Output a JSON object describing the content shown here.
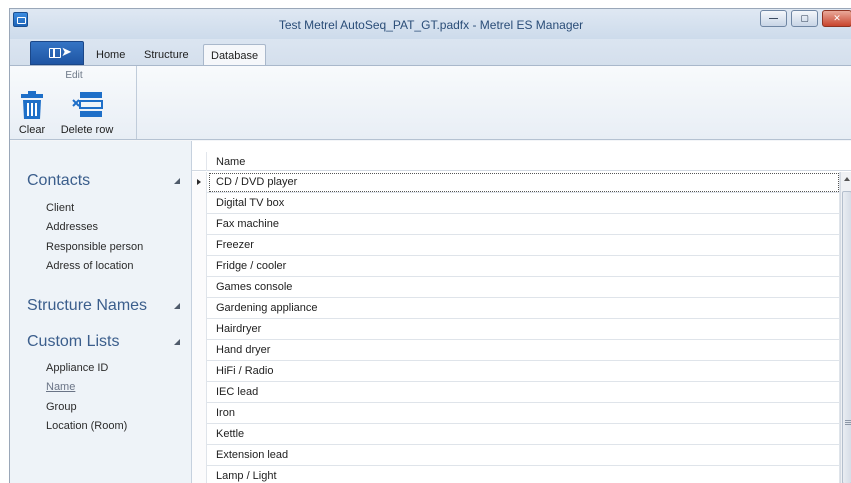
{
  "window": {
    "title": "Test Metrel AutoSeq_PAT_GT.padfx - Metrel ES Manager",
    "controls": {
      "minimize": "—",
      "maximize": "▢",
      "close": "✕"
    }
  },
  "ribbon_tabs": {
    "home": "Home",
    "structure": "Structure",
    "database": "Database",
    "active": "Database"
  },
  "ribbon": {
    "group_label": "Edit",
    "clear_label": "Clear",
    "delete_row_label": "Delete row",
    "icon_color": "#1e6fc8"
  },
  "nav": {
    "contacts": {
      "title": "Contacts",
      "items": [
        "Client",
        "Addresses",
        "Responsible person",
        "Adress of location"
      ]
    },
    "structure_names": {
      "title": "Structure Names"
    },
    "custom_lists": {
      "title": "Custom Lists",
      "items": [
        "Appliance ID",
        "Name",
        "Group",
        "Location (Room)"
      ],
      "active_item": "Name"
    }
  },
  "grid": {
    "column": "Name",
    "rows": [
      "CD / DVD player",
      "Digital TV box",
      "Fax machine",
      "Freezer",
      "Fridge / cooler",
      "Games console",
      "Gardening appliance",
      "Hairdryer",
      "Hand dryer",
      "HiFi / Radio",
      "IEC lead",
      "Iron",
      "Kettle",
      "Extension lead",
      "Lamp / Light"
    ],
    "selected_row": "CD / DVD player"
  }
}
